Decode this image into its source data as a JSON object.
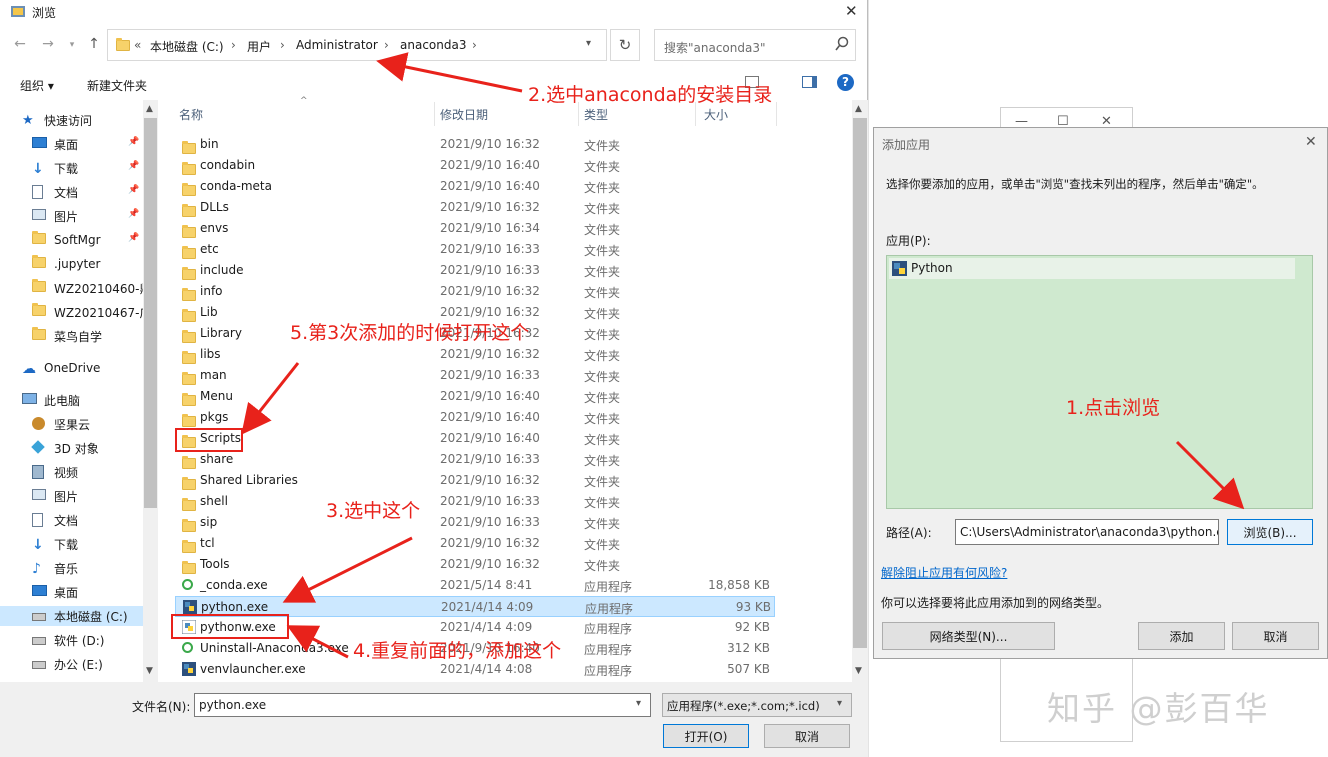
{
  "browse": {
    "title": "浏览",
    "close": "✕",
    "address": {
      "overflow": "«",
      "crumbs": [
        "本地磁盘 (C:)",
        "用户",
        "Administrator",
        "anaconda3"
      ],
      "sep": "›"
    },
    "search_placeholder": "搜索\"anaconda3\"",
    "toolbar": {
      "organize": "组织 ▾",
      "new_folder": "新建文件夹"
    },
    "columns": {
      "name": "名称",
      "date": "修改日期",
      "type": "类型",
      "size": "大小"
    },
    "nav": [
      {
        "label": "快速访问",
        "icon": "star-icon"
      },
      {
        "label": "桌面",
        "icon": "desktop-icon",
        "pinned": true
      },
      {
        "label": "下载",
        "icon": "download-icon",
        "pinned": true
      },
      {
        "label": "文档",
        "icon": "document-icon",
        "pinned": true
      },
      {
        "label": "图片",
        "icon": "picture-icon",
        "pinned": true
      },
      {
        "label": "SoftMgr",
        "icon": "folder-icon",
        "pinned": true
      },
      {
        "label": ".jupyter",
        "icon": "folder-icon"
      },
      {
        "label": "WZ20210460-鼎",
        "icon": "folder-icon"
      },
      {
        "label": "WZ20210467-广",
        "icon": "folder-icon"
      },
      {
        "label": "菜鸟自学",
        "icon": "folder-icon"
      },
      {
        "label": "OneDrive",
        "icon": "cloud-icon"
      },
      {
        "label": "此电脑",
        "icon": "pc-icon"
      },
      {
        "label": "坚果云",
        "icon": "nut-icon"
      },
      {
        "label": "3D 对象",
        "icon": "cube-icon"
      },
      {
        "label": "视频",
        "icon": "video-icon"
      },
      {
        "label": "图片",
        "icon": "picture-icon"
      },
      {
        "label": "文档",
        "icon": "document-icon"
      },
      {
        "label": "下载",
        "icon": "download-icon"
      },
      {
        "label": "音乐",
        "icon": "music-icon"
      },
      {
        "label": "桌面",
        "icon": "desktop-icon"
      },
      {
        "label": "本地磁盘 (C:)",
        "icon": "drive-icon",
        "selected": true
      },
      {
        "label": "软件 (D:)",
        "icon": "drive-icon"
      },
      {
        "label": "办公 (E:)",
        "icon": "drive-icon"
      }
    ],
    "files": [
      {
        "name": "bin",
        "date": "2021/9/10 16:32",
        "type": "文件夹",
        "size": "",
        "kind": "folder"
      },
      {
        "name": "condabin",
        "date": "2021/9/10 16:40",
        "type": "文件夹",
        "size": "",
        "kind": "folder"
      },
      {
        "name": "conda-meta",
        "date": "2021/9/10 16:40",
        "type": "文件夹",
        "size": "",
        "kind": "folder"
      },
      {
        "name": "DLLs",
        "date": "2021/9/10 16:32",
        "type": "文件夹",
        "size": "",
        "kind": "folder"
      },
      {
        "name": "envs",
        "date": "2021/9/10 16:34",
        "type": "文件夹",
        "size": "",
        "kind": "folder"
      },
      {
        "name": "etc",
        "date": "2021/9/10 16:33",
        "type": "文件夹",
        "size": "",
        "kind": "folder"
      },
      {
        "name": "include",
        "date": "2021/9/10 16:33",
        "type": "文件夹",
        "size": "",
        "kind": "folder"
      },
      {
        "name": "info",
        "date": "2021/9/10 16:32",
        "type": "文件夹",
        "size": "",
        "kind": "folder"
      },
      {
        "name": "Lib",
        "date": "2021/9/10 16:32",
        "type": "文件夹",
        "size": "",
        "kind": "folder"
      },
      {
        "name": "Library",
        "date": "2021/9/10 16:32",
        "type": "文件夹",
        "size": "",
        "kind": "folder"
      },
      {
        "name": "libs",
        "date": "2021/9/10 16:32",
        "type": "文件夹",
        "size": "",
        "kind": "folder"
      },
      {
        "name": "man",
        "date": "2021/9/10 16:33",
        "type": "文件夹",
        "size": "",
        "kind": "folder"
      },
      {
        "name": "Menu",
        "date": "2021/9/10 16:40",
        "type": "文件夹",
        "size": "",
        "kind": "folder"
      },
      {
        "name": "pkgs",
        "date": "2021/9/10 16:40",
        "type": "文件夹",
        "size": "",
        "kind": "folder"
      },
      {
        "name": "Scripts",
        "date": "2021/9/10 16:40",
        "type": "文件夹",
        "size": "",
        "kind": "folder"
      },
      {
        "name": "share",
        "date": "2021/9/10 16:33",
        "type": "文件夹",
        "size": "",
        "kind": "folder"
      },
      {
        "name": "Shared Libraries",
        "date": "2021/9/10 16:32",
        "type": "文件夹",
        "size": "",
        "kind": "folder"
      },
      {
        "name": "shell",
        "date": "2021/9/10 16:33",
        "type": "文件夹",
        "size": "",
        "kind": "folder"
      },
      {
        "name": "sip",
        "date": "2021/9/10 16:33",
        "type": "文件夹",
        "size": "",
        "kind": "folder"
      },
      {
        "name": "tcl",
        "date": "2021/9/10 16:32",
        "type": "文件夹",
        "size": "",
        "kind": "folder"
      },
      {
        "name": "Tools",
        "date": "2021/9/10 16:32",
        "type": "文件夹",
        "size": "",
        "kind": "folder"
      },
      {
        "name": "_conda.exe",
        "date": "2021/5/14 8:41",
        "type": "应用程序",
        "size": "18,858 KB",
        "kind": "app"
      },
      {
        "name": "python.exe",
        "date": "2021/4/14 4:09",
        "type": "应用程序",
        "size": "93 KB",
        "kind": "python",
        "selected": true
      },
      {
        "name": "pythonw.exe",
        "date": "2021/4/14 4:09",
        "type": "应用程序",
        "size": "92 KB",
        "kind": "pythonw"
      },
      {
        "name": "Uninstall-Anaconda3.exe",
        "date": "2021/9/10 16:40",
        "type": "应用程序",
        "size": "312 KB",
        "kind": "app"
      },
      {
        "name": "venvlauncher.exe",
        "date": "2021/4/14 4:08",
        "type": "应用程序",
        "size": "507 KB",
        "kind": "python"
      }
    ],
    "filename_label": "文件名(N):",
    "filename_value": "python.exe",
    "filter_value": "应用程序(*.exe;*.com;*.icd)",
    "open_button": "打开(O)",
    "cancel_button": "取消"
  },
  "add_app": {
    "title": "添加应用",
    "close": "✕",
    "instruction": "选择你要添加的应用，或单击\"浏览\"查找未列出的程序，然后单击\"确定\"。",
    "apps_label": "应用(P):",
    "apps": [
      "Python"
    ],
    "path_label": "路径(A):",
    "path_value": "C:\\Users\\Administrator\\anaconda3\\python.e",
    "browse_button": "浏览(B)...",
    "risk_link": "解除阻止应用有何风险?",
    "network_hint": "你可以选择要将此应用添加到的网络类型。",
    "network_button": "网络类型(N)...",
    "add_button": "添加",
    "cancel_button": "取消"
  },
  "annotations": {
    "step1": "1.点击浏览",
    "step2": "2.选中anaconda的安装目录",
    "step3": "3.选中这个",
    "step4": "4.重复前面的，添加这个",
    "step5": "5.第3次添加的时候打开这个"
  },
  "watermark": "知乎 @彭百华",
  "colors": {
    "annotation": "#e8221b",
    "selection": "#cce8ff",
    "app_list_bg": "#cfe9cf",
    "link": "#0066cc"
  }
}
